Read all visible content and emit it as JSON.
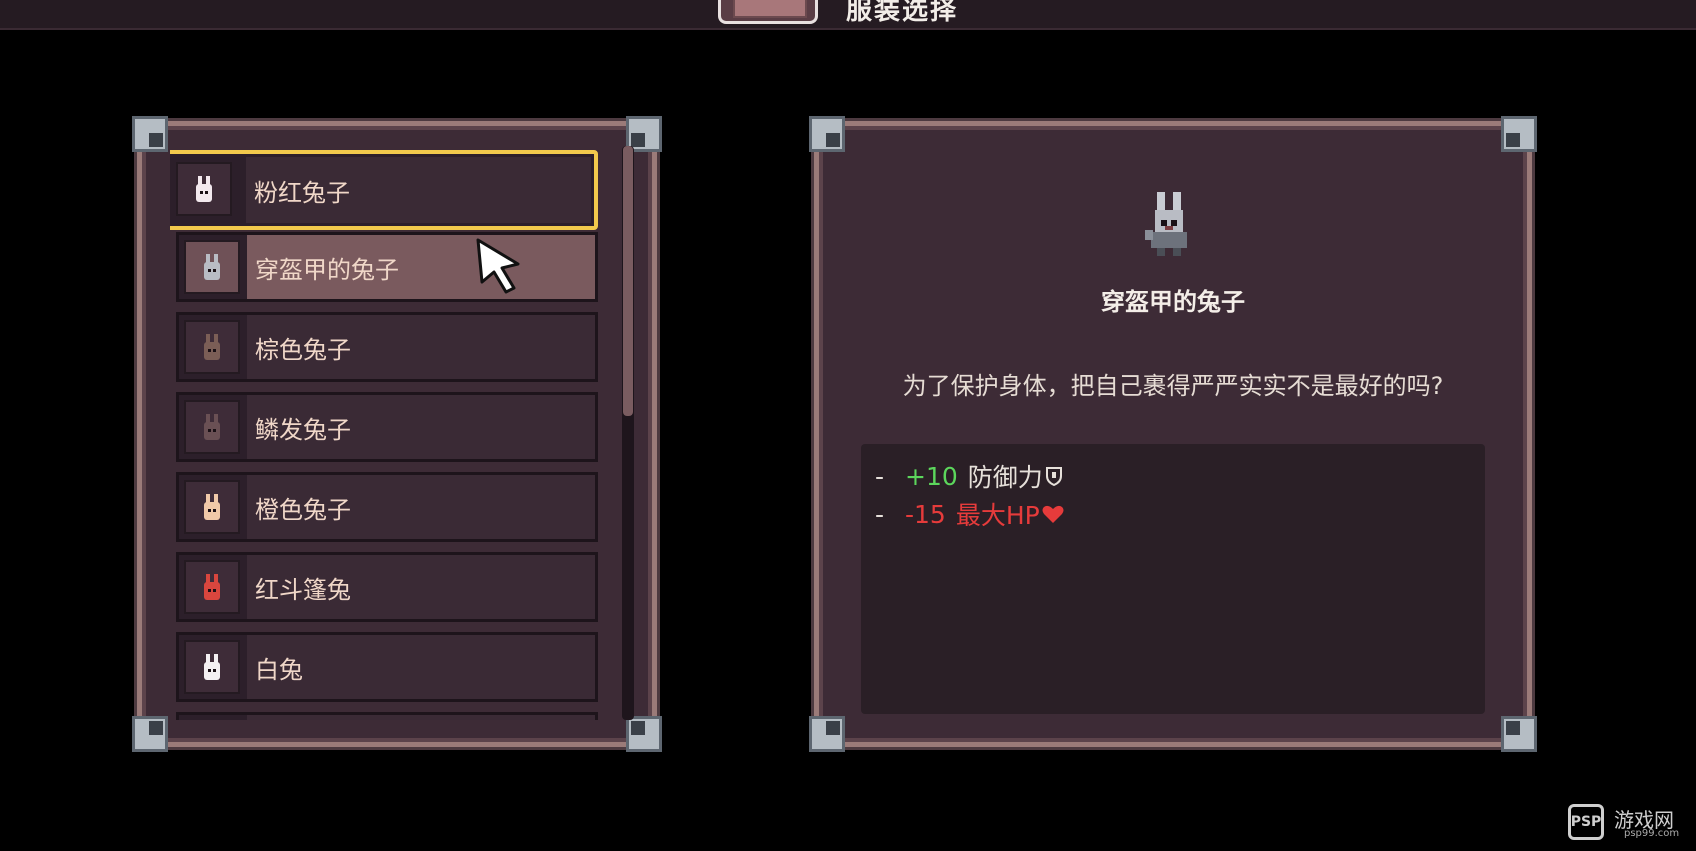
{
  "header": {
    "title": "服装选择",
    "icon": "wardrobe-icon"
  },
  "outfit_list": {
    "items": [
      {
        "label": "粉红兔子",
        "state": "selected",
        "icon": "bunny-pink-icon",
        "color": "#f3e9ee"
      },
      {
        "label": "穿盔甲的兔子",
        "state": "hovered",
        "icon": "bunny-armor-icon",
        "color": "#b9bcc4"
      },
      {
        "label": "棕色兔子",
        "state": "normal",
        "icon": "bunny-brown-icon",
        "color": "#7b5e56"
      },
      {
        "label": "鳞发兔子",
        "state": "normal",
        "icon": "bunny-scale-icon",
        "color": "#6a5054"
      },
      {
        "label": "橙色兔子",
        "state": "normal",
        "icon": "bunny-orange-icon",
        "color": "#f0c9a8"
      },
      {
        "label": "红斗篷兔",
        "state": "normal",
        "icon": "bunny-red-cloak-icon",
        "color": "#d9463e"
      },
      {
        "label": "白兔",
        "state": "normal",
        "icon": "bunny-white-icon",
        "color": "#f4f0f2"
      },
      {
        "label": "",
        "state": "normal",
        "icon": "bunny-icon",
        "color": "#7b5e56"
      }
    ],
    "scroll_fraction": 0.47
  },
  "detail": {
    "icon": "bunny-armor-icon",
    "name": "穿盔甲的兔子",
    "description": "为了保护身体，把自己裹得严严实实不是最好的吗?",
    "stats": [
      {
        "dash": "-",
        "value": "+10",
        "label": "防御力",
        "icon": "shield-icon",
        "sign": "positive"
      },
      {
        "dash": "-",
        "value": "-15",
        "label": "最大HP",
        "icon": "heart-icon",
        "sign": "negative"
      }
    ]
  },
  "watermark": {
    "logo": "PSP",
    "text": "游戏网",
    "url": "psp99.com"
  },
  "colors": {
    "selection_border": "#f2c94c",
    "positive": "#5cd65c",
    "negative": "#e63b3b",
    "panel_bg": "#3d2b36"
  }
}
